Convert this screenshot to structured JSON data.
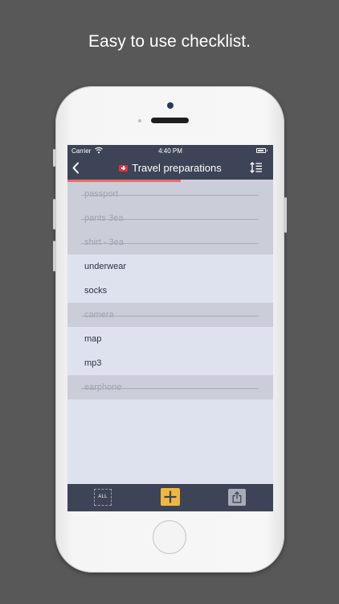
{
  "promo": {
    "headline": "Easy to use checklist."
  },
  "statusbar": {
    "carrier": "Carrier",
    "time": "4:40 PM"
  },
  "navbar": {
    "title": "Travel preparations",
    "back_icon": "chevron-left-icon",
    "flag_icon": "swiss-flag-icon",
    "sort_icon": "sort-list-icon"
  },
  "progress": {
    "completed_fraction": 0.55,
    "color": "#ee6a6a"
  },
  "checklist": {
    "items": [
      {
        "label": "passport",
        "done": true
      },
      {
        "label": "pants 3ea",
        "done": true
      },
      {
        "label": "shirt - 3ea",
        "done": true
      },
      {
        "label": "underwear",
        "done": false
      },
      {
        "label": "socks",
        "done": false
      },
      {
        "label": "camera",
        "done": true
      },
      {
        "label": "map",
        "done": false
      },
      {
        "label": "mp3",
        "done": false
      },
      {
        "label": "earphone",
        "done": true
      }
    ]
  },
  "toolbar": {
    "all_label": "ALL",
    "add_icon": "plus-icon",
    "share_icon": "share-icon"
  },
  "colors": {
    "bar": "#3d4457",
    "list_bg": "#dee1ee",
    "done_bg": "#cbced9",
    "accent": "#f2b640"
  }
}
